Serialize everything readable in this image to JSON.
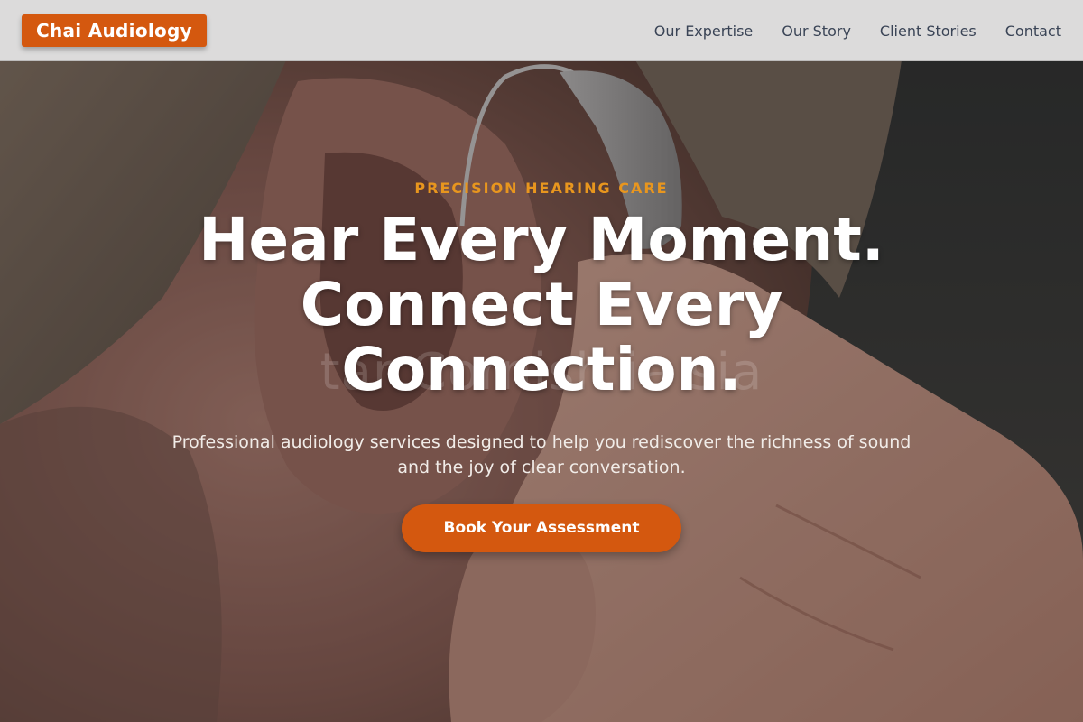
{
  "header": {
    "brand": "Chai Audiology",
    "nav": [
      {
        "label": "Our Expertise"
      },
      {
        "label": "Our Story"
      },
      {
        "label": "Client Stories"
      },
      {
        "label": "Contact"
      }
    ]
  },
  "hero": {
    "eyebrow": "PRECISION HEARING CARE",
    "headline": "Hear Every Moment. Connect Every Connection.",
    "subtext": "Professional audiology services designed to help you rediscover the richness of sound and the joy of clear conversation.",
    "cta_label": "Book Your Assessment",
    "watermark": "tar  Cornish  ia  sia",
    "image_subject": "hearing-aid-fitting-photo"
  },
  "colors": {
    "accent": "#d4580f",
    "eyebrow": "#e8961e",
    "header_bg": "#dcdbdb",
    "nav_text": "#3a4456"
  }
}
